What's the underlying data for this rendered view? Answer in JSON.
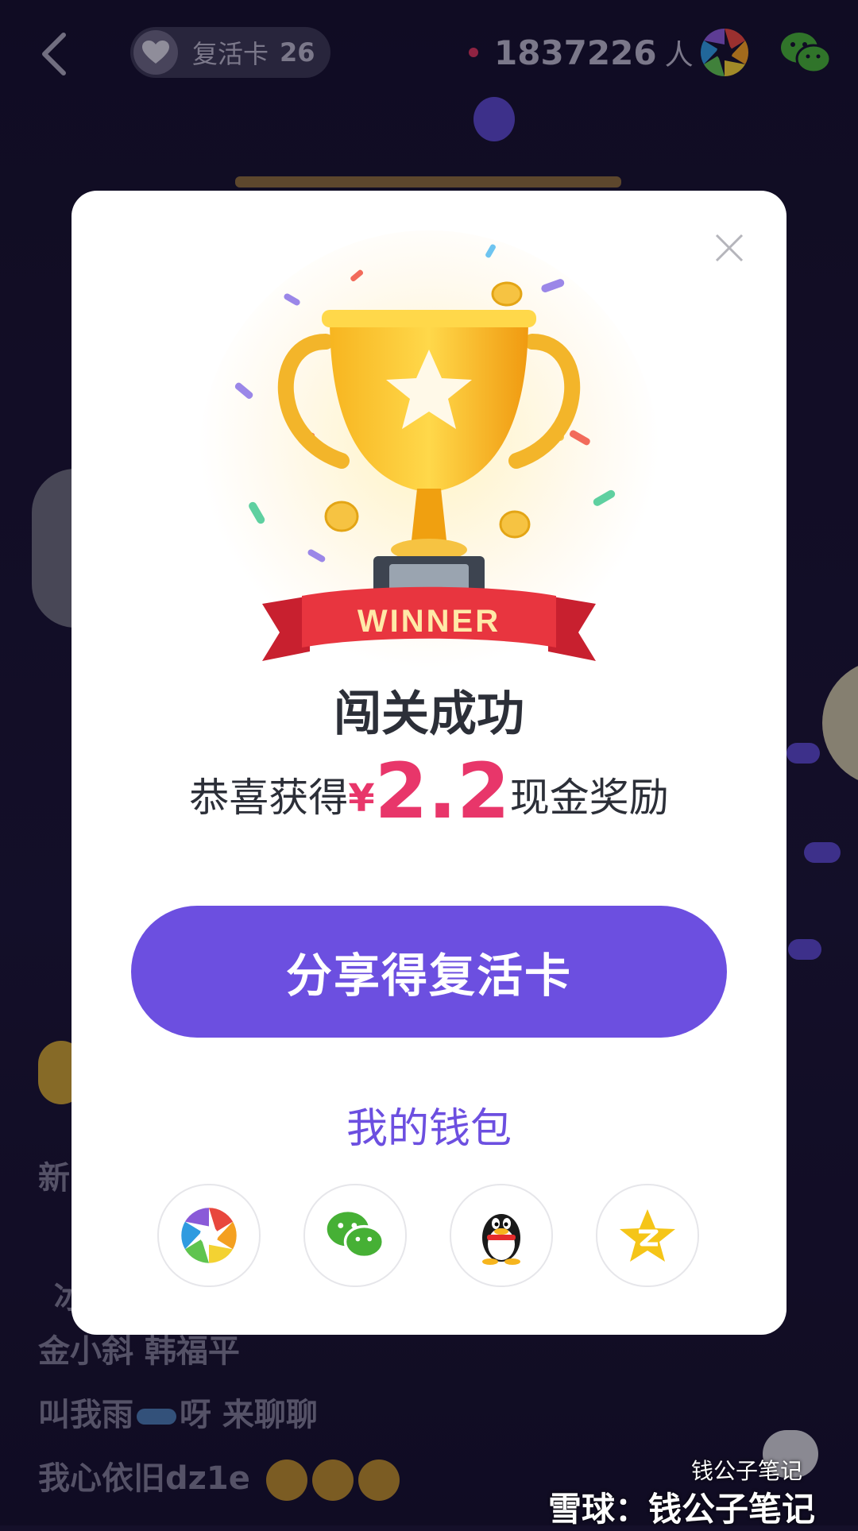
{
  "header": {
    "revive_card_label": "复活卡",
    "revive_card_count": "26",
    "viewer_count": "1837226",
    "viewer_unit": "人"
  },
  "modal": {
    "banner_text": "WINNER",
    "title": "闯关成功",
    "reward_prefix": "恭喜获得",
    "reward_currency": "¥",
    "reward_amount": "2.2",
    "reward_suffix": "现金奖励",
    "share_button_label": "分享得复活卡",
    "wallet_link": "我的钱包",
    "share_targets": [
      "moments-icon",
      "wechat-icon",
      "qq-icon",
      "qzone-icon"
    ]
  },
  "background_chat": [
    {
      "text": "新"
    },
    {
      "text": "冰"
    },
    {
      "text": "金小斜 韩福平"
    },
    {
      "text_a": "叫我雨",
      "text_b": "呀 来聊聊"
    },
    {
      "text": "我心依旧dz1e"
    }
  ],
  "watermark": {
    "left": "雪球：钱公子笔记",
    "right": "钱公子笔记"
  },
  "colors": {
    "accent_purple": "#6c4fe0",
    "reward_red": "#e8366a",
    "background": "#15102a"
  }
}
